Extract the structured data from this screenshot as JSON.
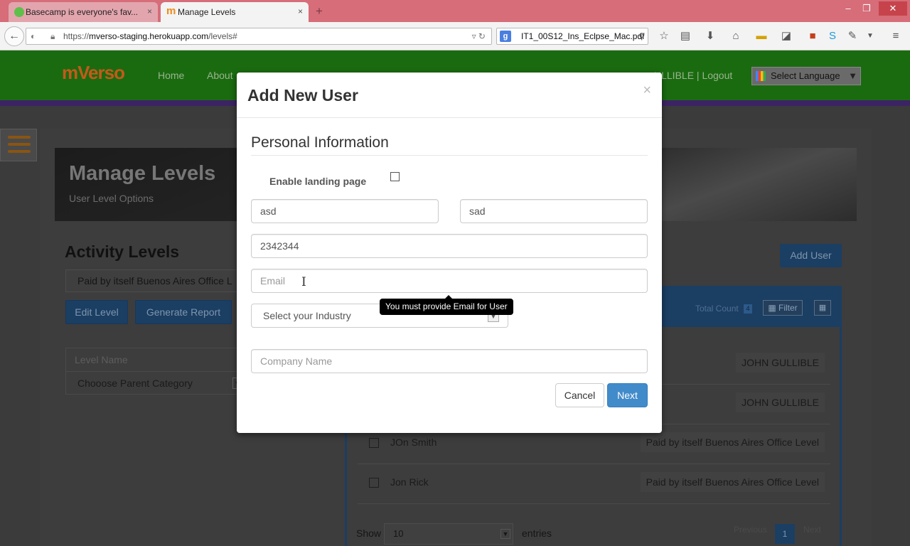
{
  "browser": {
    "tabs": [
      {
        "title": "Basecamp is everyone's fav...",
        "close": "×"
      },
      {
        "title": "Manage Levels",
        "favicon": "m",
        "close": "×"
      }
    ],
    "new_tab": "+",
    "url_prefix": "https://",
    "url_host": "mverso-staging.herokuapp.com",
    "url_path": "/levels#",
    "search_text": "IT1_00S12_Ins_Eclpse_Mac.pdf",
    "search_engine_icon": "google-icon",
    "window_controls": {
      "minimize": "–",
      "restore": "❐",
      "close": "✕"
    },
    "toolbar_icons": [
      "star-icon",
      "bookmarks-icon",
      "download-icon",
      "home-icon",
      "extension-icon",
      "extension-icon",
      "extension-icon",
      "skype-icon",
      "extension-icon",
      "menu-icon"
    ]
  },
  "site": {
    "logo": "mVerso",
    "logo_tagline": "",
    "nav": [
      "Home",
      "About"
    ],
    "user": "ULLIBLE | Logout",
    "language": "Select Language"
  },
  "page": {
    "title": "Manage Levels",
    "subtitle": "User Level Options",
    "activity_title": "Activity Levels",
    "level_select": "Paid by itself Buenos Aires Office L",
    "edit_level": "Edit Level",
    "generate_report": "Generate Report",
    "level_name_label": "Level Name",
    "parent_category": "Chooose Parent Category",
    "add_user": "Add User",
    "total_count_label": "Total Count",
    "total_count": "4",
    "filter": "Filter",
    "rows": [
      {
        "name": "",
        "level": "JOHN GULLIBLE"
      },
      {
        "name": "",
        "level": "JOHN GULLIBLE"
      },
      {
        "name": "JOn Smith",
        "level": "Paid by itself Buenos Aires Office Level"
      },
      {
        "name": "Jon Rick",
        "level": "Paid by itself Buenos Aires Office Level"
      }
    ],
    "show_label": "Show",
    "show_value": "10",
    "entries_label": "entries",
    "pagination": {
      "previous": "Previous",
      "current": "1",
      "next": "Next"
    }
  },
  "modal": {
    "title": "Add New User",
    "close": "×",
    "section": "Personal Information",
    "landing_label": "Enable landing page",
    "landing_checked": false,
    "first_name": "asd",
    "last_name": "sad",
    "phone": "2342344",
    "email_value": "",
    "email_placeholder": "Email",
    "cursor": "I",
    "tooltip": "You must provide Email for User",
    "industry": "Select your Industry",
    "company_placeholder": "Company Name",
    "cancel": "Cancel",
    "next": "Next"
  },
  "colors": {
    "header_green": "#1a6b10",
    "primary_blue": "#428bca",
    "tab_bar": "#d66d79"
  }
}
